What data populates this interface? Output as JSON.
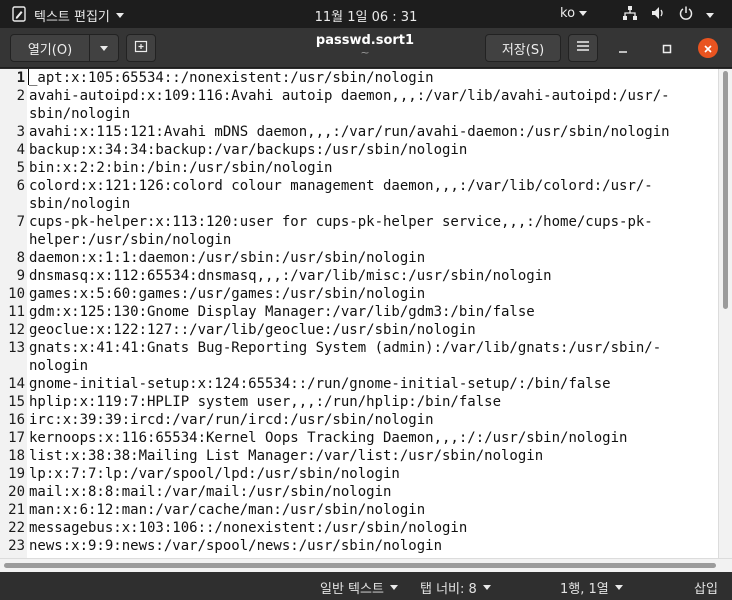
{
  "top_panel": {
    "app_menu_label": "텍스트 편집기",
    "clock": "11월 1일  06 : 31",
    "input_language": "ko"
  },
  "header": {
    "open_label": "열기(O)",
    "save_label": "저장(S)",
    "title": "passwd.sort1",
    "subtitle": "~"
  },
  "editor": {
    "current_line": 1,
    "lines": [
      {
        "num": "1",
        "text": "_apt:x:105:65534::/nonexistent:/usr/sbin/nologin"
      },
      {
        "num": "2",
        "text": "avahi-autoipd:x:109:116:Avahi autoip daemon,,,:/var/lib/avahi-autoipd:/usr/-"
      },
      {
        "num": "",
        "text": "sbin/nologin"
      },
      {
        "num": "3",
        "text": "avahi:x:115:121:Avahi mDNS daemon,,,:/var/run/avahi-daemon:/usr/sbin/nologin"
      },
      {
        "num": "4",
        "text": "backup:x:34:34:backup:/var/backups:/usr/sbin/nologin"
      },
      {
        "num": "5",
        "text": "bin:x:2:2:bin:/bin:/usr/sbin/nologin"
      },
      {
        "num": "6",
        "text": "colord:x:121:126:colord colour management daemon,,,:/var/lib/colord:/usr/-"
      },
      {
        "num": "",
        "text": "sbin/nologin"
      },
      {
        "num": "7",
        "text": "cups-pk-helper:x:113:120:user for cups-pk-helper service,,,:/home/cups-pk-"
      },
      {
        "num": "",
        "text": "helper:/usr/sbin/nologin"
      },
      {
        "num": "8",
        "text": "daemon:x:1:1:daemon:/usr/sbin:/usr/sbin/nologin"
      },
      {
        "num": "9",
        "text": "dnsmasq:x:112:65534:dnsmasq,,,:/var/lib/misc:/usr/sbin/nologin"
      },
      {
        "num": "10",
        "text": "games:x:5:60:games:/usr/games:/usr/sbin/nologin"
      },
      {
        "num": "11",
        "text": "gdm:x:125:130:Gnome Display Manager:/var/lib/gdm3:/bin/false"
      },
      {
        "num": "12",
        "text": "geoclue:x:122:127::/var/lib/geoclue:/usr/sbin/nologin"
      },
      {
        "num": "13",
        "text": "gnats:x:41:41:Gnats Bug-Reporting System (admin):/var/lib/gnats:/usr/sbin/-"
      },
      {
        "num": "",
        "text": "nologin"
      },
      {
        "num": "14",
        "text": "gnome-initial-setup:x:124:65534::/run/gnome-initial-setup/:/bin/false"
      },
      {
        "num": "15",
        "text": "hplip:x:119:7:HPLIP system user,,,:/run/hplip:/bin/false"
      },
      {
        "num": "16",
        "text": "irc:x:39:39:ircd:/var/run/ircd:/usr/sbin/nologin"
      },
      {
        "num": "17",
        "text": "kernoops:x:116:65534:Kernel Oops Tracking Daemon,,,:/:/usr/sbin/nologin"
      },
      {
        "num": "18",
        "text": "list:x:38:38:Mailing List Manager:/var/list:/usr/sbin/nologin"
      },
      {
        "num": "19",
        "text": "lp:x:7:7:lp:/var/spool/lpd:/usr/sbin/nologin"
      },
      {
        "num": "20",
        "text": "mail:x:8:8:mail:/var/mail:/usr/sbin/nologin"
      },
      {
        "num": "21",
        "text": "man:x:6:12:man:/var/cache/man:/usr/sbin/nologin"
      },
      {
        "num": "22",
        "text": "messagebus:x:103:106::/nonexistent:/usr/sbin/nologin"
      },
      {
        "num": "23",
        "text": "news:x:9:9:news:/var/spool/news:/usr/sbin/nologin"
      }
    ]
  },
  "statusbar": {
    "language": "일반 텍스트",
    "tab_width": "탭 너비: 8",
    "position": "1행, 1열",
    "mode": "삽입"
  }
}
